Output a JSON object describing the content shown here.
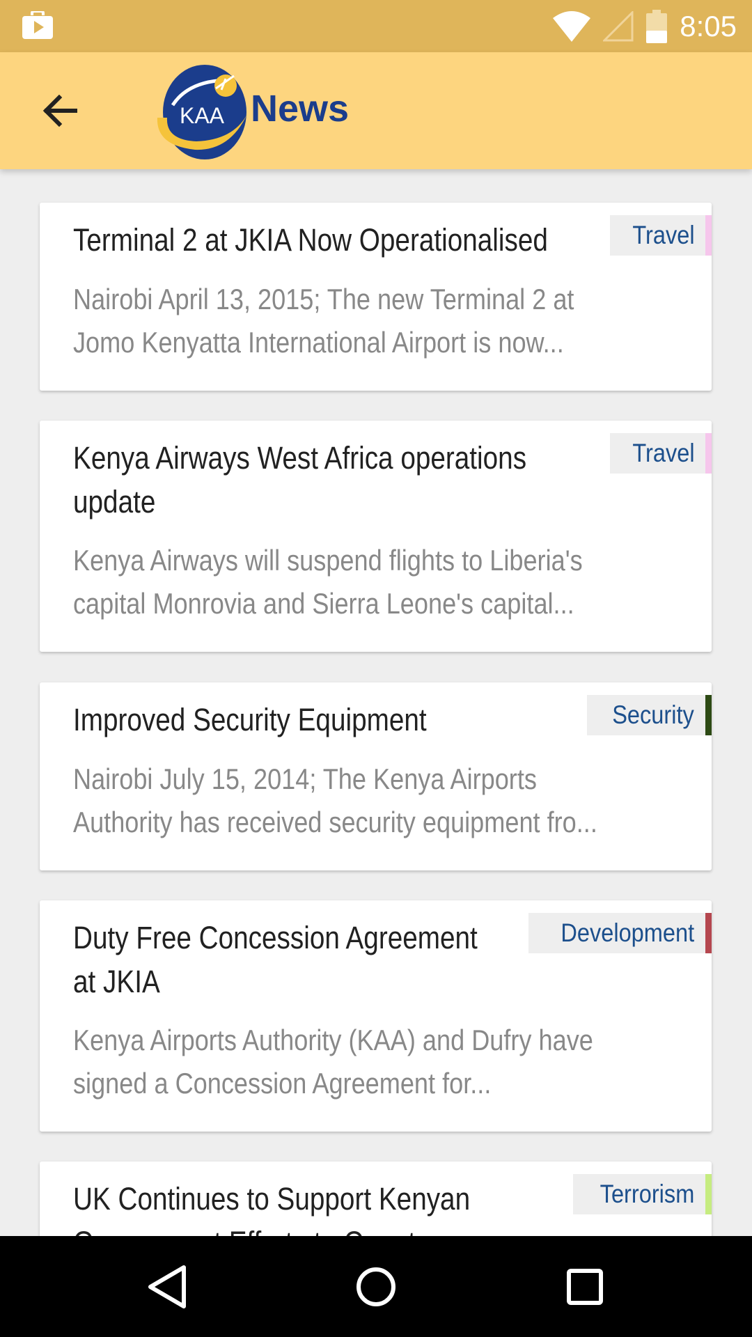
{
  "status_bar": {
    "time": "8:05",
    "icons": [
      "shopping-bag-icon",
      "wifi-icon",
      "signal-icon",
      "battery-icon"
    ],
    "background": "#dfb55a"
  },
  "app_bar": {
    "title": "News",
    "logo_text": "KAA",
    "back_icon": "arrow-back-icon",
    "background": "#fdd57f",
    "title_color": "#1b3d8c"
  },
  "news": [
    {
      "title": "Terminal 2 at JKIA Now Operationalised",
      "body_line1": "Nairobi April 13, 2015; The new Terminal 2 at",
      "body_line2": "Jomo Kenyatta International Airport is now...",
      "category": "Travel",
      "category_color": "#f6c6ec"
    },
    {
      "title": "Kenya Airways West Africa operations",
      "title_line2": "update",
      "body_line1": "Kenya Airways will suspend flights to Liberia's",
      "body_line2": "capital Monrovia and Sierra Leone's capital...",
      "category": "Travel",
      "category_color": "#f6c6ec"
    },
    {
      "title": "Improved Security Equipment",
      "body_line1": "Nairobi July 15, 2014; The Kenya Airports",
      "body_line2": "Authority has received security equipment fro...",
      "category": "Security",
      "category_color": "#2d4a14"
    },
    {
      "title": "Duty Free Concession Agreement",
      "title_line2": "at JKIA",
      "body_line1": "Kenya Airports Authority (KAA) and Dufry have",
      "body_line2": "signed a Concession Agreement for...",
      "category": "Development",
      "category_color": "#b5474f"
    },
    {
      "title": "UK Continues to Support Kenyan",
      "title_line2": "Government Efforts to Counter",
      "category": "Terrorism",
      "category_color": "#c6ec80"
    }
  ],
  "nav_bar": {
    "buttons": [
      "back-triangle-icon",
      "home-circle-icon",
      "recents-square-icon"
    ]
  }
}
